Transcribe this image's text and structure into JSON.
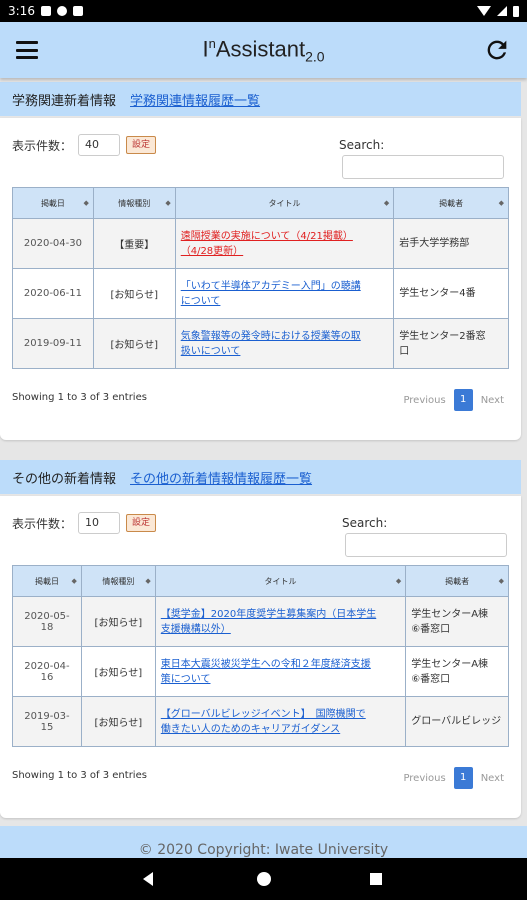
{
  "status_bar": {
    "time": "3:16"
  },
  "app": {
    "title_prefix": "I",
    "title_sup": "n",
    "title_main": "Assistant",
    "title_sub": "2.0"
  },
  "sections": [
    {
      "header": "学務関連新着情報",
      "header_link": "学務関連情報履歴一覧",
      "per_page_label": "表示件数：",
      "per_page_value": "40",
      "set_button": "設定",
      "search_label": "Search:",
      "columns": [
        "掲載日",
        "情報種別",
        "タイトル",
        "掲載者"
      ],
      "rows": [
        {
          "date": "2020-04-30",
          "type": "【重要】",
          "title_l1": "遠隔授業の実施について（4/21掲載）",
          "title_l2": "（4/28更新）",
          "poster_l1": "岩手大学学務部",
          "poster_l2": "",
          "important": true
        },
        {
          "date": "2020-06-11",
          "type": "[お知らせ]",
          "title_l1": "「いわて半導体アカデミー入門」の聴講",
          "title_l2": "について",
          "poster_l1": "学生センター4番",
          "poster_l2": "",
          "important": false
        },
        {
          "date": "2019-09-11",
          "type": "[お知らせ]",
          "title_l1": "気象警報等の発令時における授業等の取",
          "title_l2": "扱いについて",
          "poster_l1": "学生センター2番窓",
          "poster_l2": "口",
          "important": false
        }
      ],
      "showing": "Showing 1 to 3 of 3 entries",
      "pager": {
        "previous": "Previous",
        "current": "1",
        "next": "Next"
      }
    },
    {
      "header": "その他の新着情報",
      "header_link": "その他の新着情報情報履歴一覧",
      "per_page_label": "表示件数：",
      "per_page_value": "10",
      "set_button": "設定",
      "search_label": "Search:",
      "columns": [
        "掲載日",
        "情報種別",
        "タイトル",
        "掲載者"
      ],
      "rows": [
        {
          "date": "2020-05-18",
          "type": "[お知らせ]",
          "title_l1": "【奨学金】2020年度奨学生募集案内（日本学生",
          "title_l2": "支援機構以外）",
          "poster_l1": "学生センターA棟",
          "poster_l2": "⑥番窓口",
          "important": false
        },
        {
          "date": "2020-04-16",
          "type": "[お知らせ]",
          "title_l1": "東日本大震災被災学生への令和２年度経済支援",
          "title_l2": "策について",
          "poster_l1": "学生センターA棟",
          "poster_l2": "⑥番窓口",
          "important": false
        },
        {
          "date": "2019-03-15",
          "type": "[お知らせ]",
          "title_l1": "【グローバルビレッジイベント】　国際機関で",
          "title_l2": "働きたい人のためのキャリアガイダンス",
          "poster_l1": "グローバルビレッジ",
          "poster_l2": "",
          "important": false
        }
      ],
      "showing": "Showing 1 to 3 of 3 entries",
      "pager": {
        "previous": "Previous",
        "current": "1",
        "next": "Next"
      }
    }
  ],
  "footer": {
    "copyright": "© 2020 Copyright: Iwate University"
  },
  "colors": {
    "appbar": "#bcdcfa",
    "accent": "#3b7ad6",
    "link": "#1a5fd0",
    "important": "#e02020"
  }
}
